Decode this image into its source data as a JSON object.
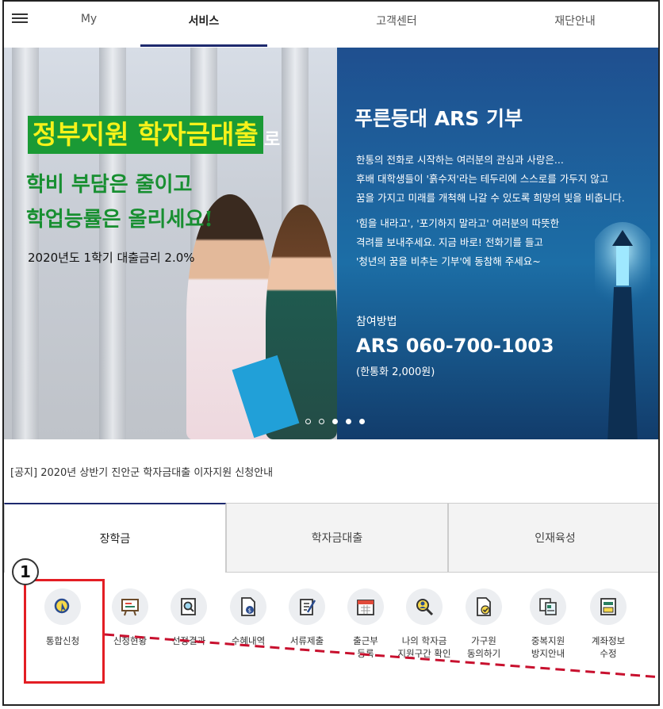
{
  "nav": {
    "items": [
      "My",
      "서비스",
      "고객센터",
      "재단안내"
    ],
    "active": "서비스"
  },
  "banner_left": {
    "headline": "정부지원 학자금대출",
    "headline_suffix": "로",
    "sub1": "학비 부담은 줄이고",
    "sub2": "학업능률은 올리세요!",
    "rate": "2020년도 1학기 대출금리 2.0%"
  },
  "banner_right": {
    "title": "푸른등대 ARS 기부",
    "body": [
      "한통의 전화로 시작하는 여러분의 관심과 사랑은...",
      "후배 대학생들이 '흙수저'라는 테두리에 스스로를 가두지 않고",
      "꿈을 가지고 미래를 개척해 나갈 수 있도록 희망의 빛을 비춥니다.",
      "'힘을 내라고', '포기하지 말라고' 여러분의 따뜻한",
      "격려를 보내주세요. 지금 바로! 전화기를 들고",
      "'청년의 꿈을 비추는 기부'에 동참해 주세요~"
    ],
    "method_label": "참여방법",
    "ars": "ARS 060-700-1003",
    "fee": "(한통화 2,000원)"
  },
  "carousel": {
    "count": 5,
    "active_index": 2
  },
  "notice": "[공지] 2020년 상반기 진안군 학자금대출 이자지원 신청안내",
  "tabs": [
    "장학금",
    "학자금대출",
    "인재육성"
  ],
  "tab_active": "장학금",
  "services": [
    {
      "line1": "통합신청",
      "line2": "",
      "icon": "magnifier-pointer-icon"
    },
    {
      "line1": "신청현황",
      "line2": "",
      "icon": "presentation-board-icon"
    },
    {
      "line1": "선정결과",
      "line2": "",
      "icon": "document-search-icon"
    },
    {
      "line1": "수혜내역",
      "line2": "",
      "icon": "document-money-icon"
    },
    {
      "line1": "서류제출",
      "line2": "",
      "icon": "document-pen-icon"
    },
    {
      "line1": "출근부",
      "line2": "등록",
      "icon": "calendar-icon"
    },
    {
      "line1": "나의 학자금",
      "line2": "지원구간 확인",
      "icon": "search-person-icon"
    },
    {
      "line1": "가구원",
      "line2": "동의하기",
      "icon": "document-check-icon"
    },
    {
      "line1": "중복지원",
      "line2": "방지안내",
      "icon": "documents-icon"
    },
    {
      "line1": "계좌정보",
      "line2": "수정",
      "icon": "bank-card-icon"
    }
  ],
  "step_badge": "1",
  "colors": {
    "accent": "#1e2a6e",
    "highlight": "#e31e24",
    "banner_green": "#1a9a35",
    "headline_yellow": "#f6f21a"
  }
}
